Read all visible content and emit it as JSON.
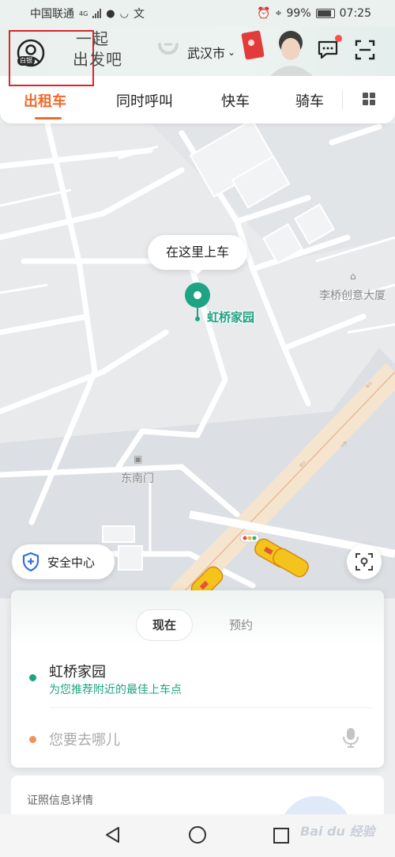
{
  "status_bar": {
    "carrier": "中国联通",
    "network": "4G",
    "battery": "99%",
    "time": "07:25",
    "ime": "文"
  },
  "header": {
    "member_badge": "白银",
    "slogan_line1": "一起",
    "slogan_line2": "出发吧",
    "city": "武汉市",
    "colors": {
      "red_highlight": "#d9262c",
      "notification_dot": "#ff4d4f"
    }
  },
  "tabs": [
    {
      "label": "出租车",
      "active": true
    },
    {
      "label": "同时呼叫",
      "active": false
    },
    {
      "label": "快车",
      "active": false
    },
    {
      "label": "骑车",
      "active": false
    }
  ],
  "accent_color": "#f06a2a",
  "map": {
    "pickup_tooltip": "在这里上车",
    "pickup_name": "虹桥家园",
    "poi_building": "李桥创意大厦",
    "poi_gate": "东南门",
    "pin_color": "#1ea383"
  },
  "safety_center_label": "安全中心",
  "booking": {
    "mode_now": "现在",
    "mode_reserve": "预约",
    "from_title": "虹桥家园",
    "from_hint": "为您推荐附近的最佳上车点",
    "to_placeholder": "您要去哪儿"
  },
  "info_card": {
    "title": "证照信息详情"
  },
  "watermark": "Bai du 经验"
}
